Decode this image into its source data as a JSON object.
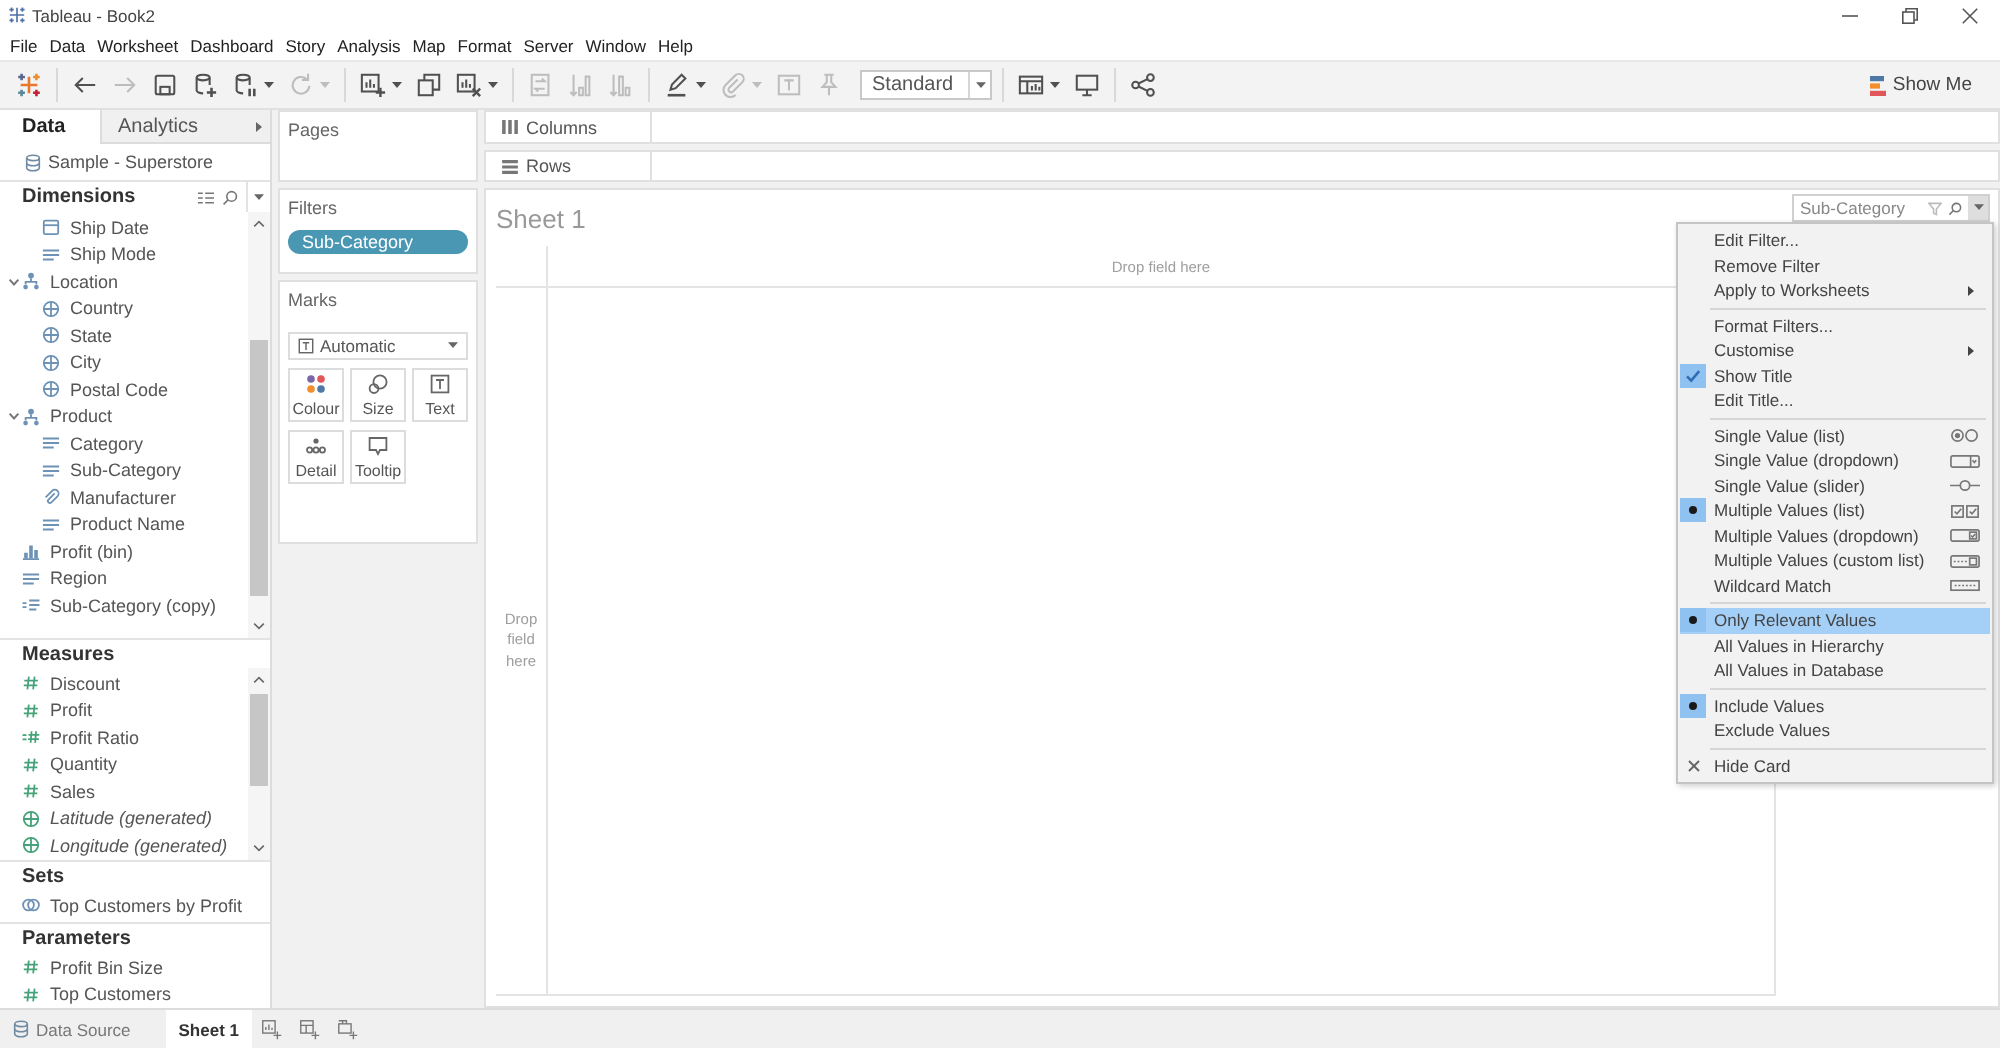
{
  "window": {
    "title": "Tableau - Book2"
  },
  "menu_bar": [
    "File",
    "Data",
    "Worksheet",
    "Dashboard",
    "Story",
    "Analysis",
    "Map",
    "Format",
    "Server",
    "Window",
    "Help"
  ],
  "toolbar": {
    "groups": [
      {
        "buttons": [
          {
            "kind": "icon",
            "dropdown": false
          }
        ]
      },
      {
        "buttons": [
          {
            "kind": "icon",
            "disabled": false,
            "dropdown": false
          },
          {
            "kind": "icon",
            "disabled": true,
            "dropdown": false
          },
          {
            "kind": "icon",
            "disabled": false,
            "dropdown": false
          },
          {
            "kind": "icon",
            "disabled": false,
            "dropdown": false
          },
          {
            "kind": "icon",
            "disabled": false,
            "dropdown": true
          },
          {
            "kind": "icon",
            "disabled": true,
            "dropdown": true
          }
        ]
      },
      {
        "buttons": [
          {
            "kind": "icon",
            "disabled": false,
            "dropdown": true
          },
          {
            "kind": "icon",
            "disabled": false,
            "dropdown": false
          },
          {
            "kind": "icon",
            "disabled": false,
            "dropdown": true
          }
        ]
      },
      {
        "buttons": [
          {
            "kind": "icon",
            "disabled": true,
            "dropdown": false
          },
          {
            "kind": "icon",
            "disabled": true,
            "dropdown": false
          },
          {
            "kind": "icon",
            "disabled": true,
            "dropdown": false
          }
        ]
      },
      {
        "buttons": [
          {
            "kind": "icon",
            "disabled": false,
            "dropdown": true
          },
          {
            "kind": "icon",
            "disabled": true,
            "dropdown": true
          },
          {
            "kind": "icon",
            "disabled": true,
            "dropdown": false
          },
          {
            "kind": "icon",
            "disabled": true,
            "dropdown": false
          },
          {
            "kind": "select",
            "value": "Standard"
          }
        ]
      },
      {
        "buttons": [
          {
            "kind": "icon",
            "disabled": false,
            "dropdown": true
          },
          {
            "kind": "icon",
            "disabled": false,
            "dropdown": false
          }
        ]
      },
      {
        "buttons": [
          {
            "kind": "icon",
            "disabled": false,
            "dropdown": false
          }
        ]
      }
    ],
    "show_me": "Show Me"
  },
  "data_pane": {
    "tabs": [
      {
        "label": "Data",
        "selected": true
      },
      {
        "label": "Analytics",
        "selected": false
      }
    ],
    "data_source": "Sample - Superstore",
    "sections": [
      {
        "kind": "dimensions",
        "title": "Dimensions",
        "items": [
          {
            "children": [
              {
                "label": "Ship Date",
                "kind": "date"
              },
              {
                "label": "Ship Mode",
                "kind": "text"
              }
            ]
          },
          {
            "label": "Location",
            "kind": "hierarchy",
            "expanded": true,
            "children": [
              {
                "label": "Country",
                "kind": "geo"
              },
              {
                "label": "State",
                "kind": "geo"
              },
              {
                "label": "City",
                "kind": "geo"
              },
              {
                "label": "Postal Code",
                "kind": "geo"
              }
            ]
          },
          {
            "label": "Product",
            "kind": "hierarchy",
            "expanded": true,
            "children": [
              {
                "label": "Category",
                "kind": "text"
              },
              {
                "label": "Sub-Category",
                "kind": "text"
              },
              {
                "label": "Manufacturer",
                "kind": "group"
              },
              {
                "label": "Product Name",
                "kind": "text"
              }
            ]
          },
          {
            "label": "Profit (bin)",
            "kind": "bin"
          },
          {
            "label": "Region",
            "kind": "text"
          },
          {
            "label": "Sub-Category (copy)",
            "kind": "calc_text"
          }
        ]
      },
      {
        "kind": "measures",
        "title": "Measures",
        "items": [
          {
            "label": "Discount",
            "kind": "measure"
          },
          {
            "label": "Profit",
            "kind": "measure"
          },
          {
            "label": "Profit Ratio",
            "kind": "calc_measure"
          },
          {
            "label": "Quantity",
            "kind": "measure"
          },
          {
            "label": "Sales",
            "kind": "measure"
          },
          {
            "label": "Latitude (generated)",
            "kind": "generated_geo"
          },
          {
            "label": "Longitude (generated)",
            "kind": "generated_geo"
          }
        ]
      },
      {
        "kind": "sets",
        "title": "Sets",
        "items": [
          {
            "label": "Top Customers by Profit",
            "kind": "set"
          }
        ]
      },
      {
        "kind": "parameters",
        "title": "Parameters",
        "items": [
          {
            "label": "Profit Bin Size",
            "kind": "param"
          },
          {
            "label": "Top Customers",
            "kind": "param"
          }
        ]
      }
    ]
  },
  "cards": {
    "pages": {
      "title": "Pages"
    },
    "filters": {
      "title": "Filters",
      "pills": [
        "Sub-Category"
      ]
    },
    "marks": {
      "title": "Marks",
      "mark_type": "Automatic",
      "properties": [
        "Colour",
        "Size",
        "Text",
        "Detail",
        "Tooltip"
      ]
    }
  },
  "shelves": [
    {
      "label": "Columns"
    },
    {
      "label": "Rows"
    }
  ],
  "sheet": {
    "title": "Sheet 1",
    "columns_drop_hint": "Drop field here",
    "rows_drop_hint": "Drop field here"
  },
  "filter_card": {
    "title": "Sub-Category"
  },
  "context_menu": {
    "sections": [
      {
        "kind": "actions",
        "items": [
          {
            "label": "Edit Filter...",
            "kind": "action",
            "highlighted": false
          },
          {
            "label": "Remove Filter",
            "kind": "action",
            "highlighted": false
          },
          {
            "label": "Apply to Worksheets",
            "kind": "submenu",
            "highlighted": false
          }
        ]
      },
      {
        "kind": "actions",
        "items": [
          {
            "label": "Format Filters...",
            "kind": "action",
            "highlighted": false
          },
          {
            "label": "Customise",
            "kind": "submenu",
            "highlighted": false
          },
          {
            "label": "Show Title",
            "kind": "check",
            "checked": true,
            "highlighted": false
          },
          {
            "label": "Edit Title...",
            "kind": "action",
            "highlighted": false
          }
        ]
      },
      {
        "kind": "modes",
        "items": [
          {
            "label": "Single Value (list)",
            "kind": "radio",
            "selected": false,
            "highlighted": false
          },
          {
            "label": "Single Value (dropdown)",
            "kind": "radio",
            "selected": false,
            "highlighted": false
          },
          {
            "label": "Single Value (slider)",
            "kind": "radio",
            "selected": false,
            "highlighted": false
          },
          {
            "label": "Multiple Values (list)",
            "kind": "radio",
            "selected": true,
            "highlighted": false
          },
          {
            "label": "Multiple Values (dropdown)",
            "kind": "radio",
            "selected": false,
            "highlighted": false
          },
          {
            "label": "Multiple Values (custom list)",
            "kind": "radio",
            "selected": false,
            "highlighted": false
          },
          {
            "label": "Wildcard Match",
            "kind": "radio",
            "selected": false,
            "highlighted": false
          }
        ]
      },
      {
        "kind": "actions",
        "items": [
          {
            "label": "Only Relevant Values",
            "kind": "radio",
            "selected": true,
            "highlighted": true
          },
          {
            "label": "All Values in Hierarchy",
            "kind": "radio",
            "selected": false,
            "highlighted": false
          },
          {
            "label": "All Values in Database",
            "kind": "radio",
            "selected": false,
            "highlighted": false
          }
        ]
      },
      {
        "kind": "actions",
        "items": [
          {
            "label": "Include Values",
            "kind": "radio",
            "selected": true,
            "highlighted": false
          },
          {
            "label": "Exclude Values",
            "kind": "radio",
            "selected": false,
            "highlighted": false
          }
        ]
      },
      {
        "kind": "actions",
        "items": [
          {
            "label": "Hide Card",
            "kind": "close",
            "highlighted": false
          }
        ]
      }
    ]
  },
  "sheet_tabs": {
    "tabs": [
      {
        "label": "Data Source",
        "kind": "data_source",
        "selected": false
      },
      {
        "label": "Sheet 1",
        "kind": "sheet",
        "selected": true
      }
    ]
  }
}
